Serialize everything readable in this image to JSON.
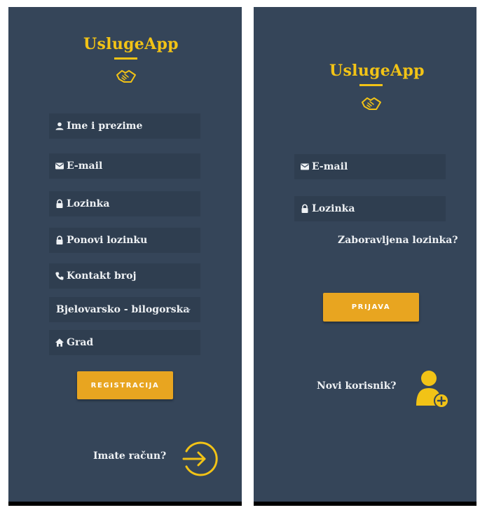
{
  "colors": {
    "background": "#354559",
    "accent": "#f2c316",
    "button": "#e8a520",
    "field": "#2f3e50"
  },
  "register": {
    "app_title": "UslugeApp",
    "fields": {
      "name": {
        "placeholder": "Ime i prezime",
        "icon": "person-icon"
      },
      "email": {
        "placeholder": "E-mail",
        "icon": "mail-icon"
      },
      "password": {
        "placeholder": "Lozinka",
        "icon": "lock-icon"
      },
      "repeat_password": {
        "placeholder": "Ponovi lozinku",
        "icon": "lock-icon"
      },
      "phone": {
        "placeholder": "Kontakt broj",
        "icon": "phone-icon"
      },
      "county": {
        "selected": "Bjelovarsko - bilogorska"
      },
      "city": {
        "placeholder": "Grad",
        "icon": "home-icon"
      }
    },
    "submit_label": "REGISTRACIJA",
    "have_account_text": "Imate račun?",
    "login_icon": "login-arrow-icon"
  },
  "login": {
    "app_title": "UslugeApp",
    "fields": {
      "email": {
        "placeholder": "E-mail",
        "icon": "mail-icon"
      },
      "password": {
        "placeholder": "Lozinka",
        "icon": "lock-icon"
      }
    },
    "forgot_password": "Zaboravljena lozinka?",
    "submit_label": "PRIJAVA",
    "new_user_text": "Novi korisnik?",
    "new_user_icon": "add-user-icon"
  }
}
